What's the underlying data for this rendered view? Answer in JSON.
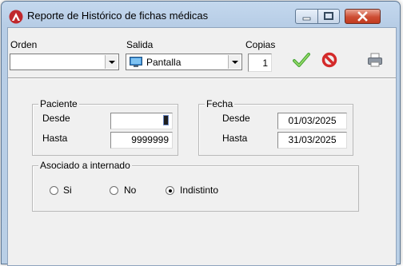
{
  "window": {
    "title": "Reporte de Histórico de fichas médicas"
  },
  "toolbar": {
    "orden_label": "Orden",
    "orden_value": "",
    "salida_label": "Salida",
    "salida_value": "Pantalla",
    "copias_label": "Copias",
    "copias_value": "1",
    "accept_icon": "checkmark-icon",
    "cancel_icon": "no-entry-icon",
    "print_icon": "printer-icon"
  },
  "paciente": {
    "legend": "Paciente",
    "desde_label": "Desde",
    "desde_value": "",
    "hasta_label": "Hasta",
    "hasta_value": "9999999"
  },
  "fecha": {
    "legend": "Fecha",
    "desde_label": "Desde",
    "desde_value": "01/03/2025",
    "hasta_label": "Hasta",
    "hasta_value": "31/03/2025"
  },
  "asociado": {
    "legend": "Asociado a internado",
    "options": [
      {
        "label": "Si",
        "selected": false
      },
      {
        "label": "No",
        "selected": false
      },
      {
        "label": "Indistinto",
        "selected": true
      }
    ]
  },
  "colors": {
    "accept": "#4aa83a",
    "cancel": "#d42a2a",
    "titlebar": "#c4d8ee",
    "close": "#c94a30"
  }
}
